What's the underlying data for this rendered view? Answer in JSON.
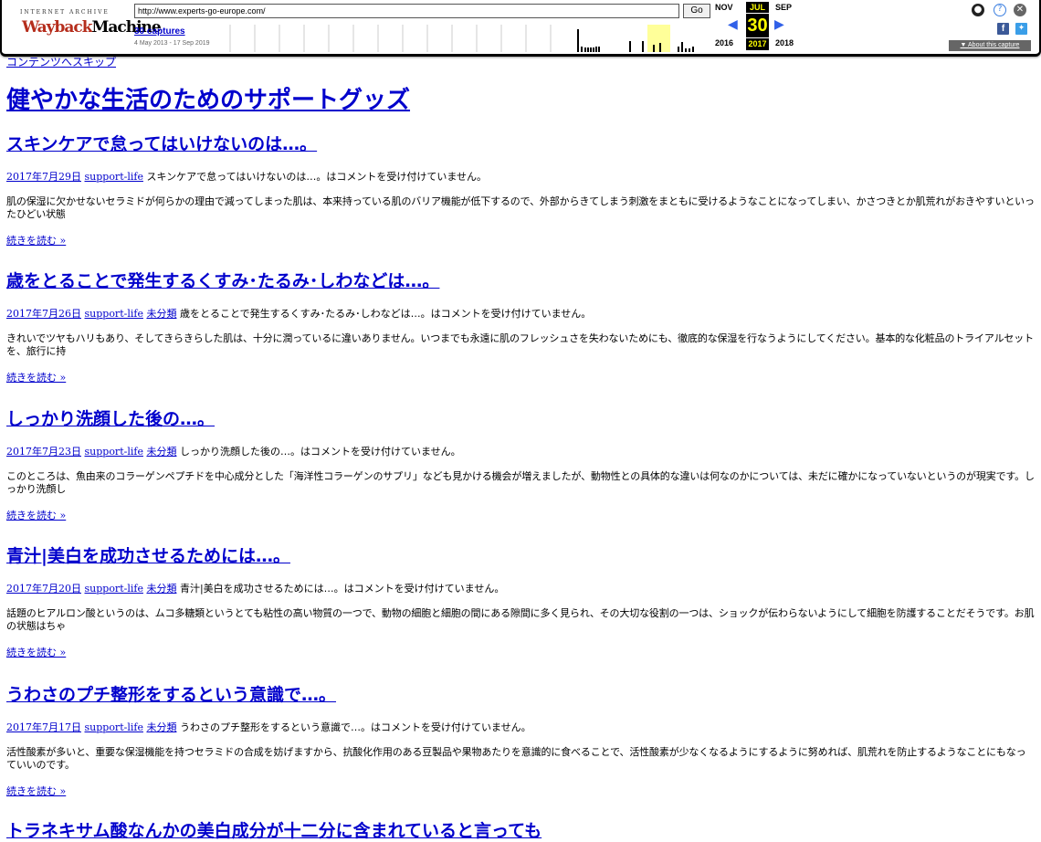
{
  "toolbar": {
    "ia_label": "INTERNET ARCHIVE",
    "logo_part1": "Wayback",
    "logo_part2": "Machine",
    "url_value": "http://www.experts-go-europe.com/",
    "go_label": "Go",
    "captures_label": "30 captures",
    "captures_range": "4 May 2013 - 17 Sep 2019",
    "month_prev": "NOV",
    "month_current": "JUL",
    "month_next": "SEP",
    "day_current": "30",
    "year_prev": "2016",
    "year_current": "2017",
    "year_next": "2018",
    "about_label": "▼ About this capture",
    "icons": {
      "user": "user-icon",
      "help": "help-icon",
      "close": "close-icon",
      "facebook": "facebook-icon",
      "twitter": "twitter-icon"
    },
    "colors": {
      "highlight": "#ffff00",
      "arrow": "#3060e8",
      "logo_red": "#b52d1c"
    }
  },
  "page": {
    "skip_link": "コンテンツへスキップ",
    "site_title": "健やかな生活のためのサポートグッズ",
    "link_color": "#0000cc",
    "read_more": "続きを読む »",
    "posts": [
      {
        "title": "スキンケアで怠ってはいけないのは…。",
        "date": "2017年7月29日",
        "author": "support-life",
        "category": "",
        "comment_note": "スキンケアで怠ってはいけないのは…。はコメントを受け付けていません。",
        "excerpt": "肌の保湿に欠かせないセラミドが何らかの理由で減ってしまった肌は、本来持っている肌のバリア機能が低下するので、外部からきてしまう刺激をまともに受けるようなことになってしまい、かさつきとか肌荒れがおきやすいといったひどい状態"
      },
      {
        "title": "歳をとることで発生するくすみ･たるみ･しわなどは…。",
        "date": "2017年7月26日",
        "author": "support-life",
        "category": "未分類",
        "comment_note": "歳をとることで発生するくすみ･たるみ･しわなどは…。はコメントを受け付けていません。",
        "excerpt": "きれいでツヤもハリもあり、そしてきらきらした肌は、十分に潤っているに違いありません。いつまでも永遠に肌のフレッシュさを失わないためにも、徹底的な保湿を行なうようにしてください。基本的な化粧品のトライアルセットを、旅行に持"
      },
      {
        "title": "しっかり洗顔した後の…。",
        "date": "2017年7月23日",
        "author": "support-life",
        "category": "未分類",
        "comment_note": "しっかり洗顔した後の…。はコメントを受け付けていません。",
        "excerpt": "このところは、魚由来のコラーゲンペプチドを中心成分とした「海洋性コラーゲンのサプリ」なども見かける機会が増えましたが、動物性との具体的な違いは何なのかについては、未だに確かになっていないというのが現実です。しっかり洗顔し"
      },
      {
        "title": "青汁|美白を成功させるためには…。",
        "date": "2017年7月20日",
        "author": "support-life",
        "category": "未分類",
        "comment_note": "青汁|美白を成功させるためには…。はコメントを受け付けていません。",
        "excerpt": "話題のヒアルロン酸というのは、ムコ多糖類というとても粘性の高い物質の一つで、動物の細胞と細胞の間にある隙間に多く見られ、その大切な役割の一つは、ショックが伝わらないようにして細胞を防護することだそうです。お肌の状態はちゃ"
      },
      {
        "title": "うわさのプチ整形をするという意識で…。",
        "date": "2017年7月17日",
        "author": "support-life",
        "category": "未分類",
        "comment_note": "うわさのプチ整形をするという意識で…。はコメントを受け付けていません。",
        "excerpt": "活性酸素が多いと、重要な保湿機能を持つセラミドの合成を妨げますから、抗酸化作用のある豆製品や果物あたりを意識的に食べることで、活性酸素が少なくなるようにするように努めれば、肌荒れを防止するようなことにもなっていいのです。"
      },
      {
        "title": "トラネキサム酸なんかの美白成分が十二分に含まれていると言っても",
        "date": "",
        "author": "",
        "category": "",
        "comment_note": "",
        "excerpt": ""
      }
    ]
  }
}
